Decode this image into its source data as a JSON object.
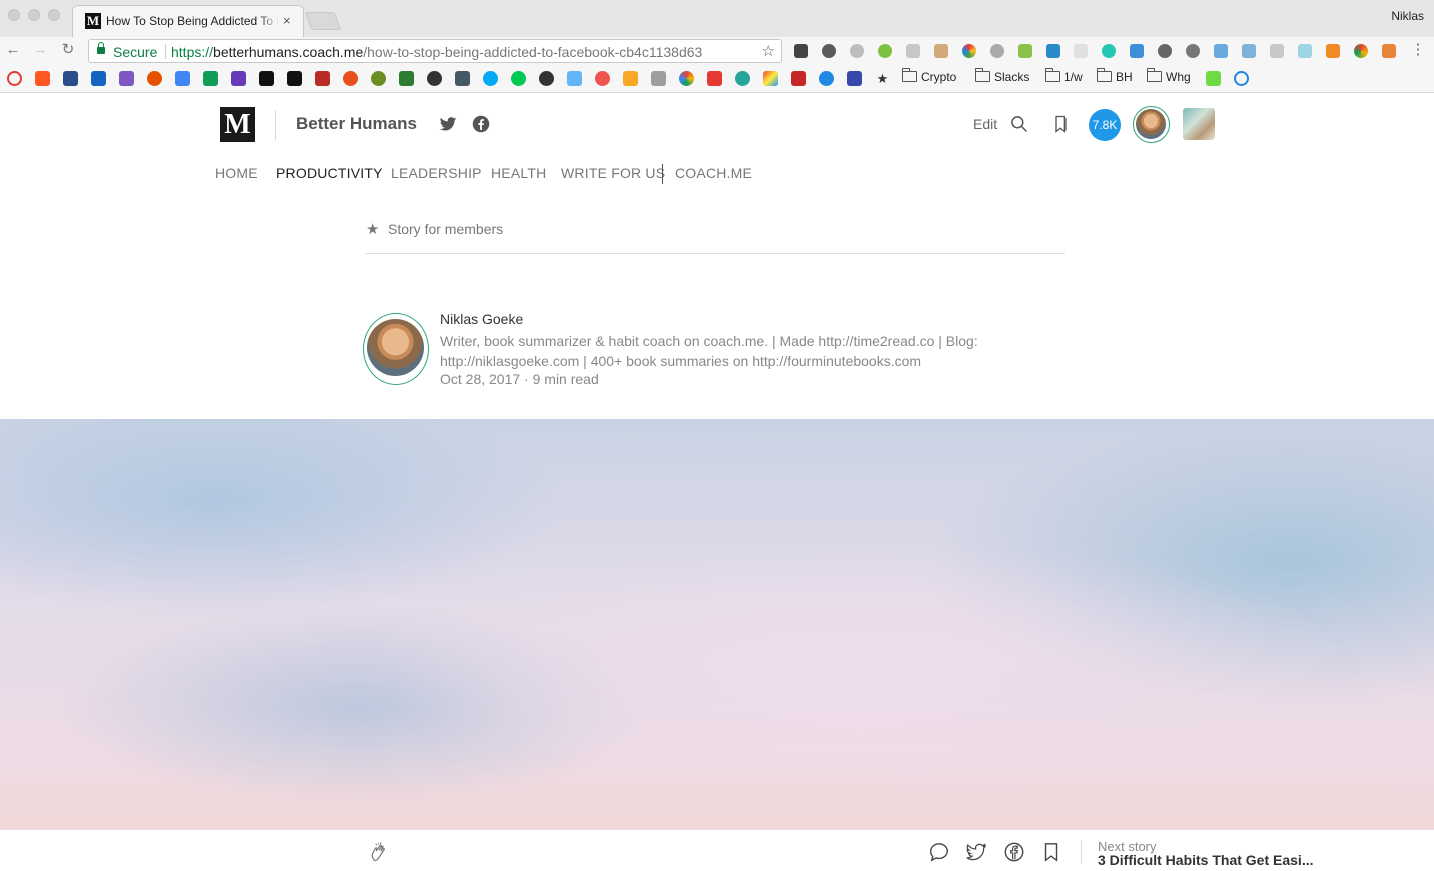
{
  "browser": {
    "tab_title": "How To Stop Being Addicted To Facebook",
    "tab_close": "×",
    "profile_name": "Niklas",
    "secure_label": "Secure",
    "url_scheme": "https://",
    "url_host": "betterhumans.coach.me",
    "url_path": "/how-to-stop-being-addicted-to-facebook-cb4c1138d63",
    "bookmark_folders": [
      "Crypto",
      "Slacks",
      "1/w",
      "BH",
      "Whg"
    ]
  },
  "header": {
    "logo": "M",
    "publication": "Better Humans",
    "edit_label": "Edit",
    "badge": "7.8K"
  },
  "nav": {
    "items": [
      "HOME",
      "PRODUCTIVITY",
      "LEADERSHIP",
      "HEALTH",
      "WRITE FOR US",
      "COACH.ME"
    ],
    "active": "PRODUCTIVITY"
  },
  "article": {
    "member_label": "Story for members",
    "author_name": "Niklas Goeke",
    "author_bio": "Writer, book summarizer & habit coach on coach.me. | Made http://time2read.co | Blog: http://niklasgoeke.com | 400+ book summaries on http://fourminutebooks.com",
    "meta": "Oct 28, 2017 · 9 min read"
  },
  "footer": {
    "next_label": "Next story",
    "next_title": "3 Difficult Habits That Get Easi..."
  },
  "colors": {
    "secure_green": "#0b8043",
    "badge_blue": "#1f98e8",
    "avatar_ring": "#2fa37f"
  }
}
